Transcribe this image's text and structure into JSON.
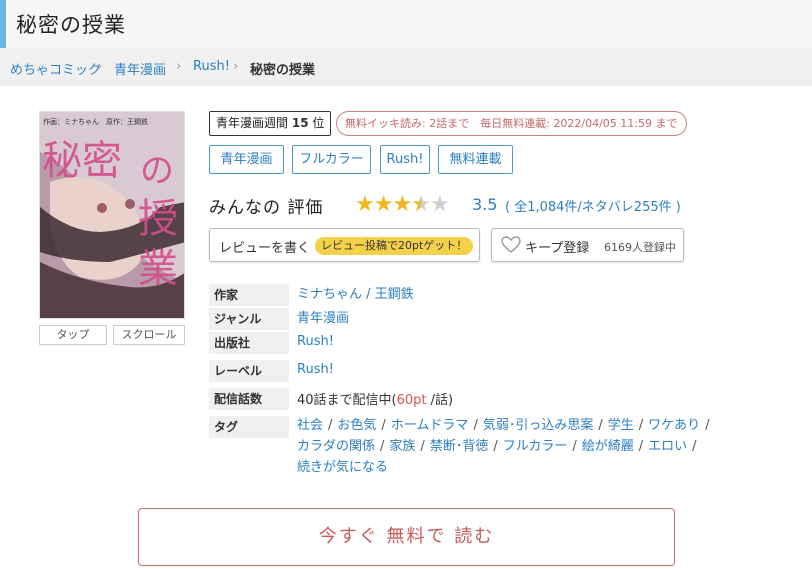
{
  "page_title": "秘密の授業",
  "breadcrumb": [
    {
      "label": "めちゃコミック"
    },
    {
      "label": "青年漫画"
    },
    {
      "label": "Rush!"
    },
    {
      "label": "秘密の授業"
    }
  ],
  "cover": {
    "title_art": "秘密の授業",
    "credit_line": "作画：ミナちゃん　原作：王鋼鉄",
    "tap_label": "タップ",
    "scroll_label": "スクロール"
  },
  "badges": {
    "rank_text": "青年漫画週間",
    "rank_number": "15",
    "rank_unit": "位",
    "free_text": "無料イッキ読み: 2話まで　毎日無料連載: 2022/04/05 11:59 まで"
  },
  "tag_chips": [
    "青年漫画",
    "フルカラー",
    "Rush!",
    "無料連載"
  ],
  "rating": {
    "label": "みんなの 評価",
    "value": 3.5,
    "score_text": "3.5",
    "count_text": "( 全1,084件/ネタバレ255件 )",
    "color": "#f0b722"
  },
  "review_button": {
    "label": "レビューを書く",
    "promo": "レビュー投稿で20ptゲット！"
  },
  "keep_button": {
    "icon": "heart-icon",
    "label": "キープ登録",
    "count": "6169人登録中"
  },
  "info": {
    "author_label": "作家",
    "author_value": "ミナちゃん / 王鋼鉄",
    "genre_label": "ジャンル",
    "genre_value": "青年漫画",
    "publisher_label": "出版社",
    "publisher_value": "Rush!",
    "label_label": "レーベル",
    "label_value": "Rush!",
    "episodes_label": "配信話数",
    "episodes_prefix": "40話まで配信中(",
    "episodes_price": "60pt",
    "episodes_suffix": " /話)",
    "tags_label": "タグ",
    "tags": [
      "社会",
      "お色気",
      "ホームドラマ",
      "気弱･引っ込み思案",
      "学生",
      "ワケあり",
      "カラダの関係",
      "家族",
      "禁断･背徳",
      "フルカラー",
      "絵が綺麗",
      "エロい",
      "続きが気になる"
    ]
  },
  "read_button": {
    "label": "今すぐ 無料で 読む",
    "color": "#c45b5b"
  }
}
